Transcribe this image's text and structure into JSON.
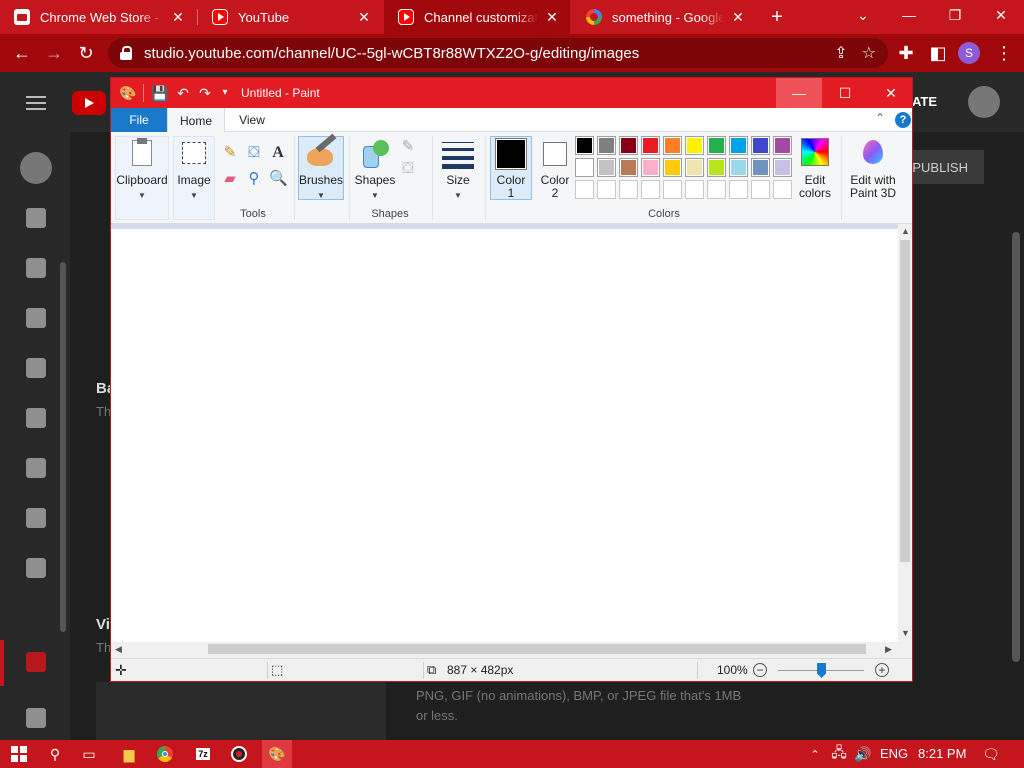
{
  "browser": {
    "tabs": [
      {
        "title": "Chrome Web Store - Ex",
        "favicon": "store-icon"
      },
      {
        "title": "YouTube",
        "favicon": "youtube-icon"
      },
      {
        "title": "Channel customization",
        "favicon": "youtube-icon",
        "active": true
      },
      {
        "title": "something - Google Se",
        "favicon": "google-icon"
      }
    ],
    "url": "studio.youtube.com/channel/UC--5gl-wCBT8r88WTXZ2O-g/editing/images",
    "profile_initial": "S"
  },
  "studio": {
    "create_label": "ATE",
    "publish_label": "PUBLISH",
    "section1_title": "Ba",
    "section1_sub": "Th",
    "section2_title": "Vi",
    "section2_sub": "Th",
    "info_text": "PNG, GIF (no animations), BMP, or JPEG file that's 1MB or less."
  },
  "paint": {
    "title": "Untitled - Paint",
    "tabs": {
      "file": "File",
      "home": "Home",
      "view": "View"
    },
    "ribbon": {
      "clipboard": "Clipboard",
      "image": "Image",
      "tools_group": "Tools",
      "brushes": "Brushes",
      "shapes": "Shapes",
      "shapes_group": "Shapes",
      "size": "Size",
      "color1_line1": "Color",
      "color1_line2": "1",
      "color2_line1": "Color",
      "color2_line2": "2",
      "colors_group": "Colors",
      "edit_colors_line1": "Edit",
      "edit_colors_line2": "colors",
      "paint3d_line1": "Edit with",
      "paint3d_line2": "Paint 3D"
    },
    "palette_row1": [
      "#000000",
      "#7f7f7f",
      "#880015",
      "#ed1c24",
      "#ff7f27",
      "#fff200",
      "#22b14c",
      "#00a2e8",
      "#3f48cc",
      "#a349a4"
    ],
    "palette_row2": [
      "#ffffff",
      "#c3c3c3",
      "#b97a57",
      "#ffaec9",
      "#ffc90e",
      "#efe4b0",
      "#b5e61d",
      "#99d9ea",
      "#7092be",
      "#c8bfe7"
    ],
    "color1": "#000000",
    "color2": "#ffffff",
    "status": {
      "canvas_size": "887 × 482px",
      "zoom": "100%"
    }
  },
  "taskbar": {
    "language": "ENG",
    "time": "8:21 PM"
  }
}
